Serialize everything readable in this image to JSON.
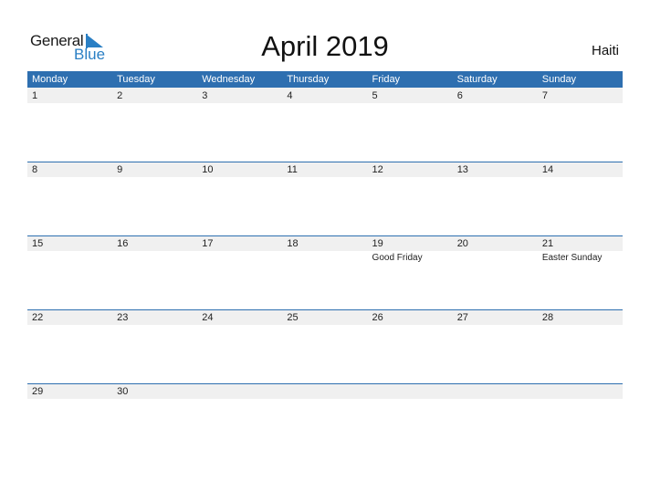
{
  "logo": {
    "text_general": "General",
    "text_blue": "Blue"
  },
  "title": "April 2019",
  "country": "Haiti",
  "colors": {
    "accent": "#2e6fb0",
    "band": "#f0f0f0",
    "logo_blue": "#2a7fc4"
  },
  "weekdays": [
    "Monday",
    "Tuesday",
    "Wednesday",
    "Thursday",
    "Friday",
    "Saturday",
    "Sunday"
  ],
  "weeks": [
    [
      {
        "day": "1"
      },
      {
        "day": "2"
      },
      {
        "day": "3"
      },
      {
        "day": "4"
      },
      {
        "day": "5"
      },
      {
        "day": "6"
      },
      {
        "day": "7"
      }
    ],
    [
      {
        "day": "8"
      },
      {
        "day": "9"
      },
      {
        "day": "10"
      },
      {
        "day": "11"
      },
      {
        "day": "12"
      },
      {
        "day": "13"
      },
      {
        "day": "14"
      }
    ],
    [
      {
        "day": "15"
      },
      {
        "day": "16"
      },
      {
        "day": "17"
      },
      {
        "day": "18"
      },
      {
        "day": "19",
        "holiday": "Good Friday"
      },
      {
        "day": "20"
      },
      {
        "day": "21",
        "holiday": "Easter Sunday"
      }
    ],
    [
      {
        "day": "22"
      },
      {
        "day": "23"
      },
      {
        "day": "24"
      },
      {
        "day": "25"
      },
      {
        "day": "26"
      },
      {
        "day": "27"
      },
      {
        "day": "28"
      }
    ],
    [
      {
        "day": "29"
      },
      {
        "day": "30"
      },
      {
        "day": ""
      },
      {
        "day": ""
      },
      {
        "day": ""
      },
      {
        "day": ""
      },
      {
        "day": ""
      }
    ]
  ]
}
